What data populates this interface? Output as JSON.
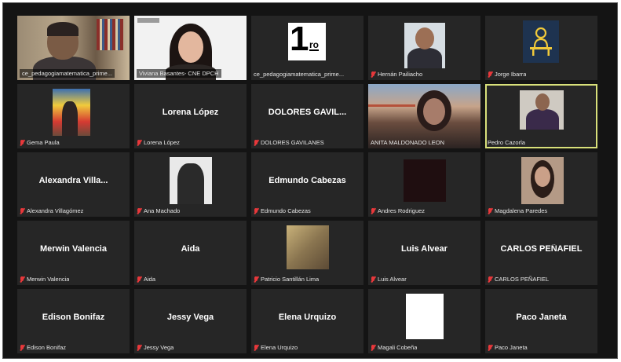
{
  "participants": [
    {
      "label": "ce_pedagogiamatematica_prime...",
      "big": "",
      "muted": false,
      "boxed": true
    },
    {
      "label": "Viviana Basantes- CNE DPCH",
      "big": "",
      "muted": false,
      "boxed": true
    },
    {
      "label": "ce_pedagogiamatematica_prime...",
      "big": "",
      "muted": false,
      "boxed": false
    },
    {
      "label": "Hernán Pailiacho",
      "big": "",
      "muted": true,
      "boxed": false
    },
    {
      "label": "Jorge Ibarra",
      "big": "",
      "muted": true,
      "boxed": false
    },
    {
      "label": "Gema Paula",
      "big": "",
      "muted": true,
      "boxed": false
    },
    {
      "label": "Lorena López",
      "big": "Lorena López",
      "muted": true,
      "boxed": false
    },
    {
      "label": "DOLORES GAVILANES",
      "big": "DOLORES GAVIL...",
      "muted": true,
      "boxed": false
    },
    {
      "label": "ANITA MALDONADO LEON",
      "big": "",
      "muted": false,
      "boxed": false
    },
    {
      "label": "Pedro Cazorla",
      "big": "",
      "muted": false,
      "boxed": false
    },
    {
      "label": "Alexandra Villagómez",
      "big": "Alexandra Villa...",
      "muted": true,
      "boxed": false
    },
    {
      "label": "Ana Machado",
      "big": "",
      "muted": true,
      "boxed": false
    },
    {
      "label": "Edmundo Cabezas",
      "big": "Edmundo Cabezas",
      "muted": true,
      "boxed": false
    },
    {
      "label": "Andres Rodriguez",
      "big": "",
      "muted": true,
      "boxed": false
    },
    {
      "label": "Magdalena Paredes",
      "big": "",
      "muted": true,
      "boxed": false
    },
    {
      "label": "Merwin Valencia",
      "big": "Merwin Valencia",
      "muted": true,
      "boxed": false
    },
    {
      "label": "Aida",
      "big": "Aida",
      "muted": true,
      "boxed": false
    },
    {
      "label": "Patricio Santillán Lima",
      "big": "",
      "muted": true,
      "boxed": false
    },
    {
      "label": "Luis Alvear",
      "big": "Luis Alvear",
      "muted": true,
      "boxed": false
    },
    {
      "label": "CARLOS PEÑAFIEL",
      "big": "CARLOS PEÑAFIEL",
      "muted": true,
      "boxed": false
    },
    {
      "label": "Edison Bonifaz",
      "big": "Edison Bonifaz",
      "muted": true,
      "boxed": false
    },
    {
      "label": "Jessy Vega",
      "big": "Jessy Vega",
      "muted": true,
      "boxed": false
    },
    {
      "label": "Elena Urquizo",
      "big": "Elena Urquizo",
      "muted": true,
      "boxed": false
    },
    {
      "label": "Magali Cobeña",
      "big": "",
      "muted": true,
      "boxed": false
    },
    {
      "label": "Paco Janeta",
      "big": "Paco Janeta",
      "muted": true,
      "boxed": false
    }
  ],
  "number_graphic": {
    "digit": "1",
    "suffix": "ro"
  },
  "active_speaker_index": 9,
  "colors": {
    "background": "#141414",
    "tile": "#262626",
    "active_border": "#d8e07a",
    "muted_icon": "#e8383b"
  },
  "icons": {
    "muted": "muted-mic-icon",
    "avatar_jorge": "person-at-desk-icon"
  }
}
